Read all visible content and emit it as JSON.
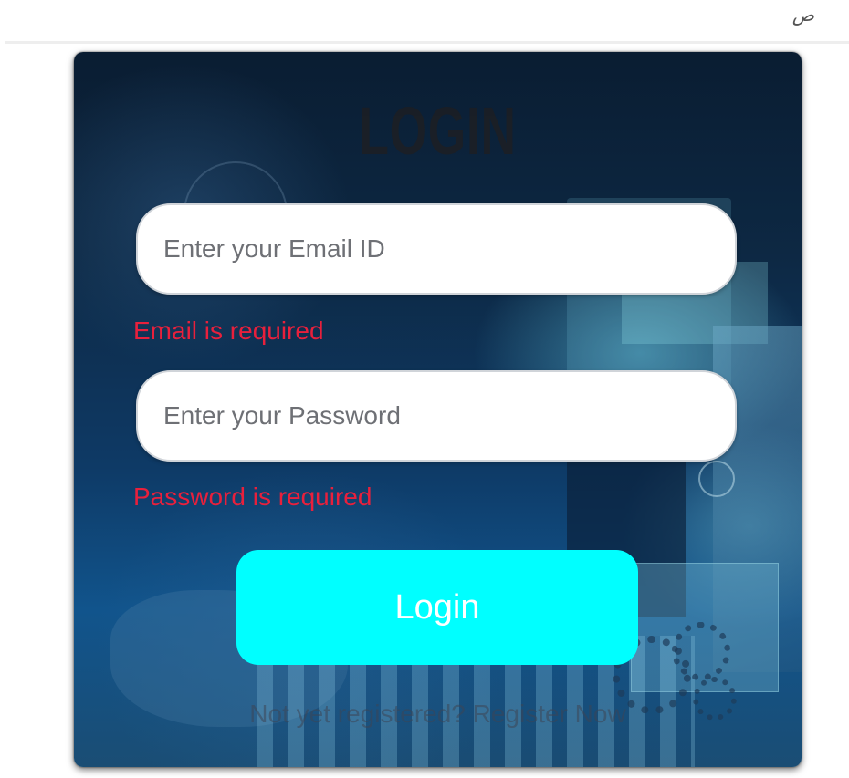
{
  "header": {
    "glyph": "ص"
  },
  "card": {
    "title": "LOGIN",
    "email": {
      "placeholder": "Enter your Email ID",
      "value": "",
      "error": "Email is required"
    },
    "password": {
      "placeholder": "Enter your Password",
      "value": "",
      "error": "Password is required"
    },
    "submit_label": "Login",
    "register": {
      "prompt": "Not yet registered? ",
      "link_label": "Register Now"
    }
  },
  "colors": {
    "error": "#e8203c",
    "button": "#00ffff",
    "title": "#1d1f24"
  }
}
